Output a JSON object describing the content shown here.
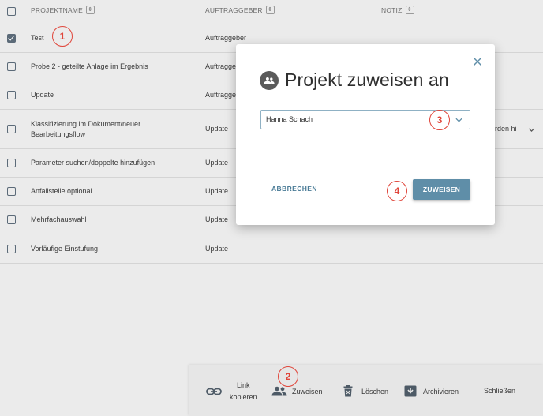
{
  "table": {
    "headers": [
      "PROJEKTNAME",
      "AUFTRAGGEBER",
      "NOTIZ"
    ],
    "sort_icon": "sort-updown-icon",
    "rows": [
      {
        "name": "Test",
        "client": "Auftraggeber",
        "note": "",
        "checked": true
      },
      {
        "name": "Probe 2 - geteilte Anlage im Ergebnis",
        "client": "Auftraggeber",
        "note": "",
        "checked": false
      },
      {
        "name": "Update",
        "client": "Auftraggeber",
        "note": "",
        "checked": false
      },
      {
        "name": "Klassifizierung im Dokument/neuer",
        "name2": "Bearbeitungsflow",
        "client": "Update",
        "note": "rden hi",
        "checked": false
      },
      {
        "name": "Parameter suchen/doppelte hinzufügen",
        "client": "Update",
        "note": "",
        "checked": false
      },
      {
        "name": "Anfallstelle optional",
        "client": "Update",
        "note": "",
        "checked": false
      },
      {
        "name": "Mehrfachauswahl",
        "client": "Update",
        "note": "",
        "checked": false
      },
      {
        "name": "Vorläufige Einstufung",
        "client": "Update",
        "note": "",
        "checked": false
      }
    ]
  },
  "markers": [
    "1",
    "2",
    "3",
    "4"
  ],
  "toolbar": {
    "link_label_1": "Link",
    "link_label_2": "kopieren",
    "assign_label": "Zuweisen",
    "delete_label": "Löschen",
    "archive_label": "Archivieren",
    "close_label": "Schließen"
  },
  "modal": {
    "title": "Projekt zuweisen an",
    "select_value": "Hanna Schach",
    "cancel_label": "ABBRECHEN",
    "confirm_label": "ZUWEISEN"
  },
  "colors": {
    "accent": "#5f8ea8",
    "accent_text": "#4b7c97",
    "marker": "#e0453a",
    "background": "#ebebeb"
  }
}
